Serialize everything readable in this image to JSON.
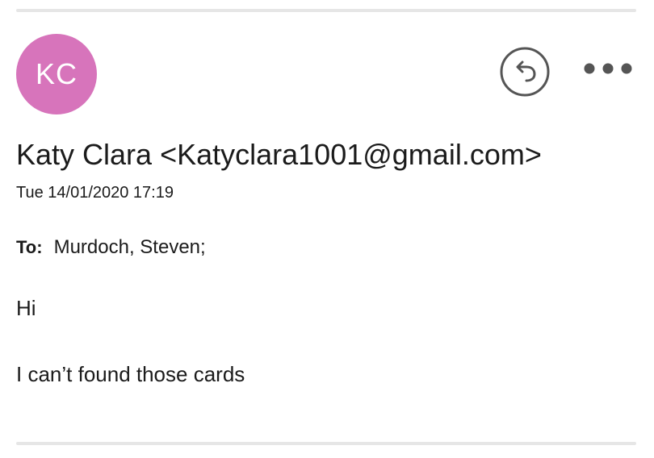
{
  "avatar": {
    "initials": "KC",
    "color": "#d774bb"
  },
  "actions": {
    "reply_icon": "reply-arrow",
    "more_icon": "ellipsis-horizontal"
  },
  "message": {
    "sender_display": "Katy Clara <Katyclara1001@gmail.com>",
    "date": "Tue 14/01/2020 17:19",
    "to_label": "To:",
    "to_recipient": "Murdoch, Steven;",
    "body": {
      "line1": "Hi",
      "line2": "I can’t found those cards"
    }
  }
}
